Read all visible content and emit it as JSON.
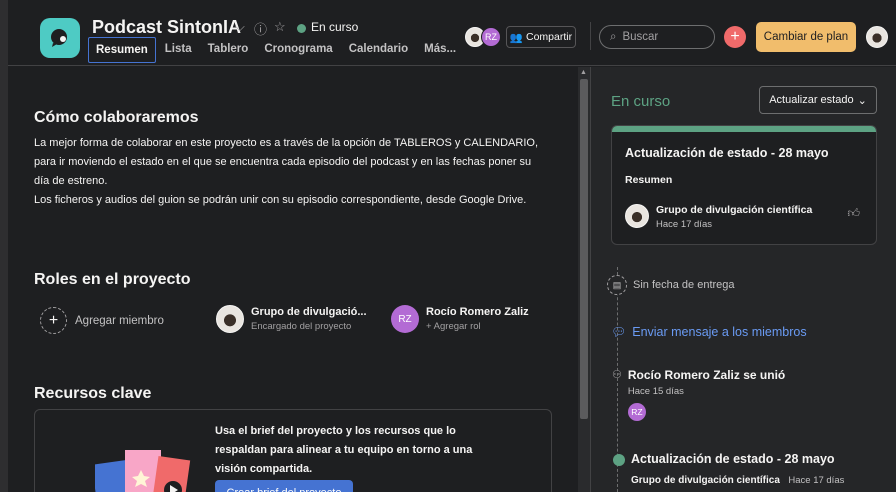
{
  "project": {
    "title": "Podcast SintonIA",
    "status": "En curso",
    "status_color": "#5da283",
    "icon": "chat-bubble-icon"
  },
  "tabs": [
    {
      "label": "Resumen",
      "active": true
    },
    {
      "label": "Lista"
    },
    {
      "label": "Tablero"
    },
    {
      "label": "Cronograma"
    },
    {
      "label": "Calendario"
    },
    {
      "label": "Más..."
    }
  ],
  "header": {
    "avatar_initials": "RZ",
    "share_label": "Compartir",
    "search_placeholder": "Buscar",
    "upgrade_label": "Cambiar de plan"
  },
  "main": {
    "collab_title": "Cómo colaboraremos",
    "collab_lines": [
      "La mejor forma de colaborar en este proyecto es a través de la opción de TABLEROS y CALENDARIO,",
      "para ir moviendo el estado en el que se encuentra cada episodio del podcast y en las fechas poner su",
      "día de estreno.",
      "Los ficheros y audios del guion se podrán unir con su episodio correspondiente, desde Google Drive."
    ],
    "roles_title": "Roles en el proyecto",
    "add_member_label": "Agregar miembro",
    "roles": [
      {
        "name": "Grupo de divulgació...",
        "sub": "Encargado del proyecto"
      },
      {
        "name": "Rocío Romero Zaliz",
        "sub": "+ Agregar rol",
        "initials": "RZ"
      }
    ],
    "resources_title": "Recursos clave",
    "resources_text": "Usa el brief del proyecto y los recursos que lo respaldan para alinear a tu equipo en torno a una visión compartida.",
    "resources_button": "Crear brief del proyecto"
  },
  "side": {
    "status_title": "En curso",
    "update_button": "Actualizar estado",
    "card": {
      "title": "Actualización de estado - 28 mayo",
      "summary_label": "Resumen",
      "author": "Grupo de divulgación científica",
      "time": "Hace 17 días"
    },
    "due_date": "Sin fecha de entrega",
    "message_link": "Enviar mensaje a los miembros",
    "joined": {
      "text": "Rocío Romero Zaliz se unió",
      "time": "Hace 15 días",
      "initials": "RZ"
    },
    "last_update": {
      "title": "Actualización de estado - 28 mayo",
      "author": "Grupo de divulgación científica",
      "time": "Hace 17 días"
    }
  }
}
